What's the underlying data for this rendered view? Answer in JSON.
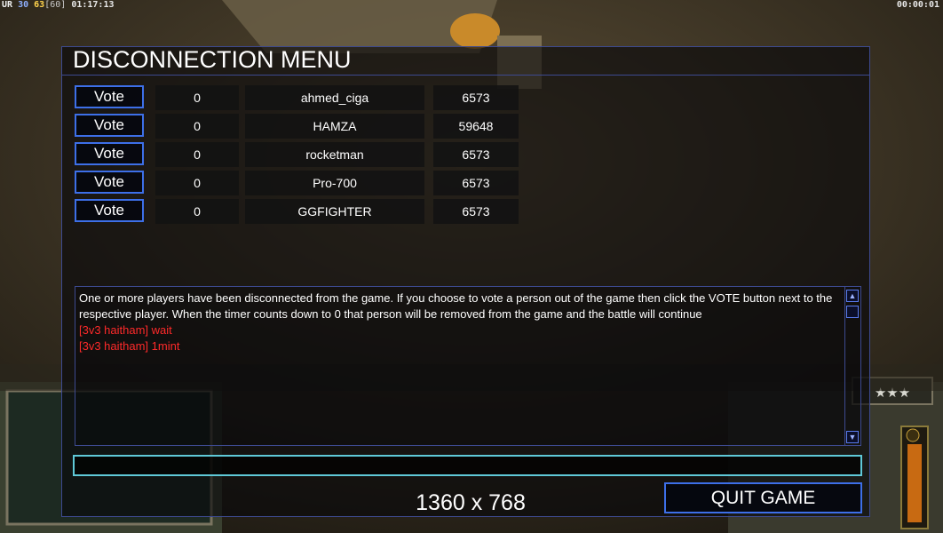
{
  "hud": {
    "top_left": {
      "ur": "UR",
      "val1": "30",
      "val2": "63",
      "val3": "[60]",
      "time": "01:17:13"
    },
    "top_right_timer": "00:00:01"
  },
  "menu": {
    "title": "DISCONNECTION MENU",
    "players": [
      {
        "vote_label": "Vote",
        "timer": "0",
        "name": "ahmed_ciga",
        "ping": "6573"
      },
      {
        "vote_label": "Vote",
        "timer": "0",
        "name": "HAMZA",
        "ping": "59648"
      },
      {
        "vote_label": "Vote",
        "timer": "0",
        "name": "rocketman",
        "ping": "6573"
      },
      {
        "vote_label": "Vote",
        "timer": "0",
        "name": "Pro-700",
        "ping": "6573"
      },
      {
        "vote_label": "Vote",
        "timer": "0",
        "name": "GGFIGHTER",
        "ping": "6573"
      }
    ],
    "chat": {
      "info": "One or more players have been disconnected from the game. If you choose to vote a person out of the game then click the VOTE button next to the respective player. When the timer counts down to 0 that person will be removed from the game and the battle will continue",
      "messages": [
        "[3v3 haitham] wait",
        "[3v3 haitham] 1mint"
      ],
      "input_value": ""
    },
    "resolution": "1360 x 768",
    "quit_label": "QUIT GAME"
  },
  "colors": {
    "accent_border": "#3d6fe8",
    "chat_red": "#ff2a2a",
    "input_border": "#5fc9d8"
  },
  "icons": {
    "scroll_up": "arrow-up-icon",
    "scroll_down": "arrow-down-icon"
  }
}
